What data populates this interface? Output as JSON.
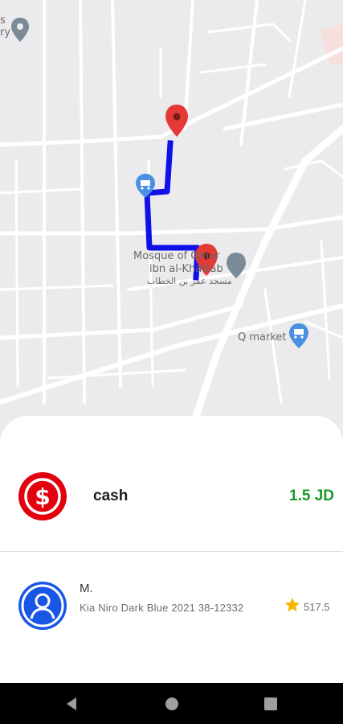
{
  "map": {
    "labels": {
      "partial_top_left_1": "s",
      "partial_top_left_2": "ry",
      "mosque_en_line1": "Mosque of Omar",
      "mosque_en_line2": "ibn al-Khattab",
      "mosque_ar": "مسجد عمر بن الخطاب",
      "market": "Q market"
    },
    "route_color": "#1010e8",
    "pin_color": "#e53935"
  },
  "trip": {
    "payment_method": "cash",
    "fare": "1.5 JD",
    "payment_icon_color": "#e3000f",
    "fare_color": "#179a2a"
  },
  "driver": {
    "name": "M.",
    "car": "Kia Niro Dark Blue 2021 38-12332",
    "rating": "517.5",
    "avatar_color": "#1a56e6"
  },
  "nav": {
    "back": "back-icon",
    "home": "home-icon",
    "recents": "recents-icon"
  }
}
